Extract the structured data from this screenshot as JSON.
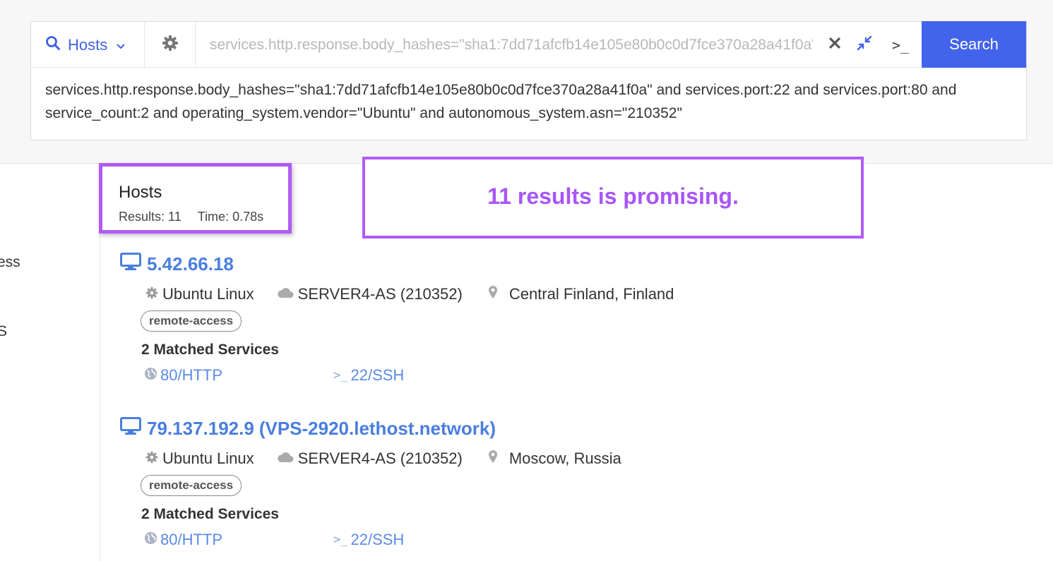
{
  "search": {
    "type_label": "Hosts",
    "query_value": "services.http.response.body_hashes=\"sha1:7dd71afcfb14e105e80b0c0d7fce370a28a41f0a\"",
    "button_label": "Search",
    "terminal_label": ">_",
    "expanded_query": "services.http.response.body_hashes=\"sha1:7dd71afcfb14e105e80b0c0d7fce370a28a41f0a\" and services.port:22 and services.port:80 and service_count:2 and operating_system.vendor=\"Ubuntu\" and autonomous_system.asn=\"210352\""
  },
  "rail": {
    "item1": "ess",
    "item2": "S"
  },
  "hosts": {
    "title": "Hosts",
    "results_text": "Results: 11",
    "time_text": "Time: 0.78s"
  },
  "callout": {
    "text": "11 results is promising."
  },
  "results": [
    {
      "ip": "5.42.66.18",
      "hostname": "",
      "os": "Ubuntu Linux",
      "asn": "SERVER4-AS (210352)",
      "location": "Central Finland, Finland",
      "tag": "remote-access",
      "matched": "2 Matched Services",
      "services": [
        "80/HTTP",
        "22/SSH"
      ]
    },
    {
      "ip": "79.137.192.9",
      "hostname": "(VPS-2920.lethost.network)",
      "os": "Ubuntu Linux",
      "asn": "SERVER4-AS (210352)",
      "location": "Moscow, Russia",
      "tag": "remote-access",
      "matched": "2 Matched Services",
      "services": [
        "80/HTTP",
        "22/SSH"
      ]
    }
  ],
  "colors": {
    "accent": "#4263eb",
    "link": "#4a7ede",
    "highlight": "#b05bf7"
  },
  "icons": [
    "search-icon",
    "chevron-down-icon",
    "gear-icon",
    "close-icon",
    "collapse-icon",
    "terminal-icon",
    "monitor-icon",
    "cloud-icon",
    "map-pin-icon",
    "globe-icon"
  ]
}
